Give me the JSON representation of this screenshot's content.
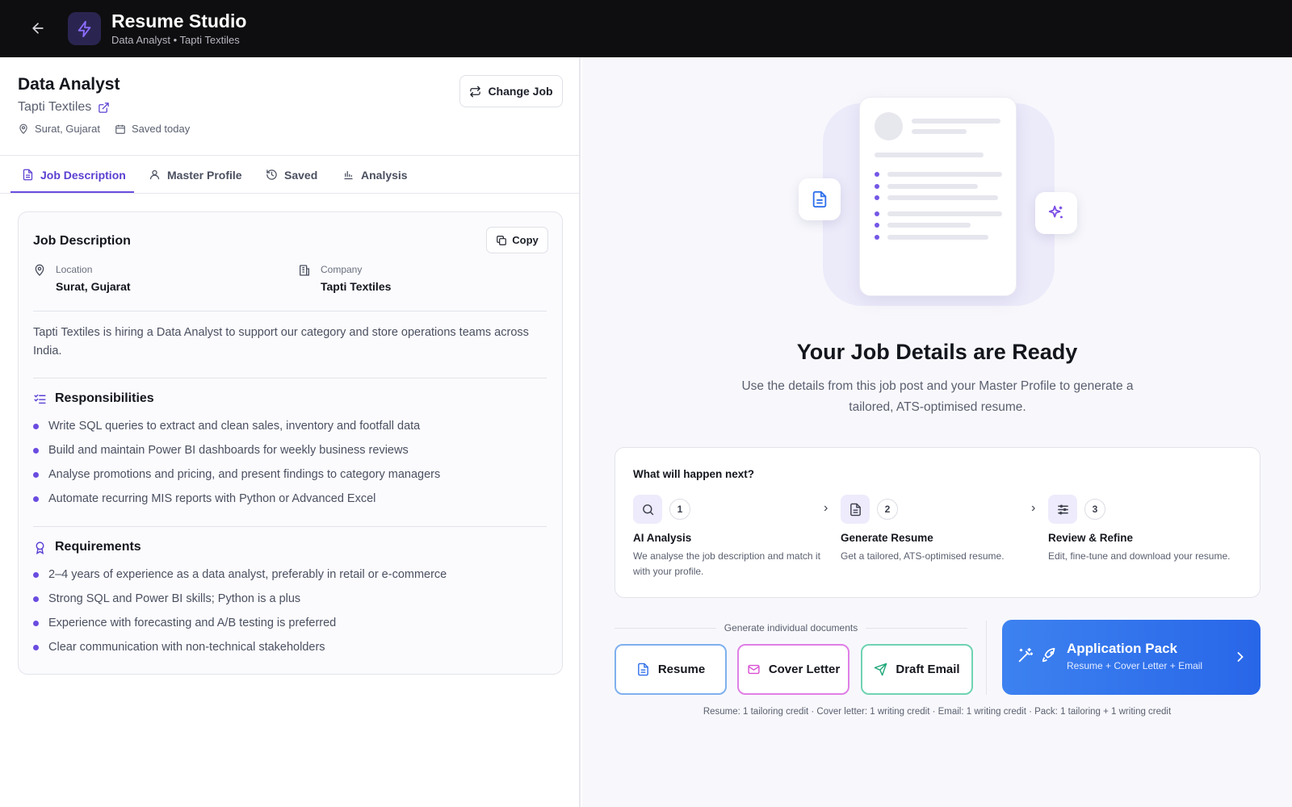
{
  "header": {
    "title": "Resume Studio",
    "subtitle": "Data Analyst • Tapti Textiles",
    "back_icon": "arrow-left-icon",
    "logo_icon": "lightning-icon"
  },
  "job": {
    "title": "Data Analyst",
    "company": "Tapti Textiles",
    "location": "Surat, Gujarat",
    "saved": "Saved today",
    "change_job_label": "Change Job"
  },
  "tabs": [
    {
      "label": "Job Description",
      "icon": "document-icon",
      "active": true
    },
    {
      "label": "Master Profile",
      "icon": "user-icon",
      "active": false
    },
    {
      "label": "Saved",
      "icon": "history-icon",
      "active": false
    },
    {
      "label": "Analysis",
      "icon": "bar-chart-icon",
      "active": false
    }
  ],
  "jd": {
    "heading": "Job Description",
    "copy_label": "Copy",
    "location_label": "Location",
    "location_value": "Surat, Gujarat",
    "company_label": "Company",
    "company_value": "Tapti Textiles",
    "summary": "Tapti Textiles is hiring a Data Analyst to support our category and store operations teams across India.",
    "responsibilities_title": "Responsibilities",
    "responsibilities": [
      "Write SQL queries to extract and clean sales, inventory and footfall data",
      "Build and maintain Power BI dashboards for weekly business reviews",
      "Analyse promotions and pricing, and present findings to category managers",
      "Automate recurring MIS reports with Python or Advanced Excel"
    ],
    "requirements_title": "Requirements",
    "requirements": [
      "2–4 years of experience as a data analyst, preferably in retail or e-commerce",
      "Strong SQL and Power BI skills; Python is a plus",
      "Experience with forecasting and A/B testing is preferred",
      "Clear communication with non-technical stakeholders"
    ]
  },
  "ready": {
    "title": "Your Job Details are Ready",
    "subtitle": "Use the details from this job post and your Master Profile to generate a tailored, ATS-optimised resume."
  },
  "next": {
    "title": "What will happen next?",
    "steps": [
      {
        "num": "1",
        "name": "AI Analysis",
        "desc": "We analyse the job description and match it with your profile.",
        "icon": "search-icon"
      },
      {
        "num": "2",
        "name": "Generate Resume",
        "desc": "Get a tailored, ATS-optimised resume.",
        "icon": "document-icon"
      },
      {
        "num": "3",
        "name": "Review & Refine",
        "desc": "Edit, fine-tune and download your resume.",
        "icon": "sliders-icon"
      }
    ]
  },
  "generate": {
    "label": "Generate individual documents",
    "resume": "Resume",
    "cover_letter": "Cover Letter",
    "draft_email": "Draft Email",
    "pack_title": "Application Pack",
    "pack_sub": "Resume + Cover Letter + Email",
    "credits": "Resume: 1 tailoring credit · Cover letter: 1 writing credit · Email: 1 writing credit · Pack: 1 tailoring + 1 writing credit"
  },
  "colors": {
    "accent": "#6a4ce0",
    "topbar": "#0e0e10",
    "resume_border": "#7fb0ee",
    "cover_border": "#e07fe6",
    "email_border": "#6fd3b2",
    "pack_blue": "#2f6fea"
  }
}
